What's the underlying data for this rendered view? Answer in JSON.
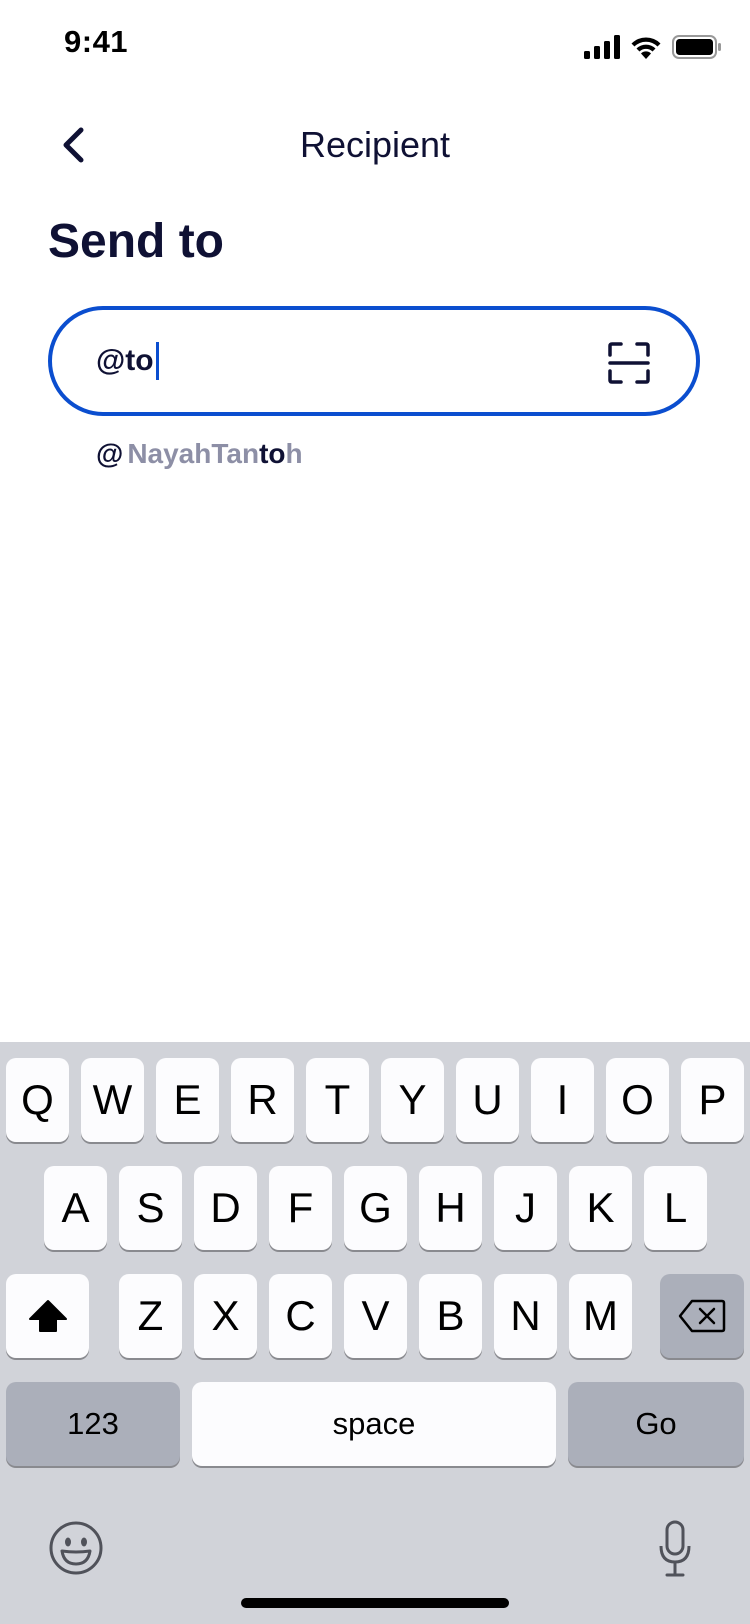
{
  "status": {
    "time": "9:41"
  },
  "header": {
    "title": "Recipient"
  },
  "page": {
    "title": "Send to"
  },
  "recipient_field": {
    "value": "@to"
  },
  "suggestion": {
    "at": "@",
    "prefix": "NayahTan",
    "match": "to",
    "suffix": "h"
  },
  "keyboard": {
    "row1": [
      "Q",
      "W",
      "E",
      "R",
      "T",
      "Y",
      "U",
      "I",
      "O",
      "P"
    ],
    "row2": [
      "A",
      "S",
      "D",
      "F",
      "G",
      "H",
      "J",
      "K",
      "L"
    ],
    "row3": [
      "Z",
      "X",
      "C",
      "V",
      "B",
      "N",
      "M"
    ],
    "numbers_label": "123",
    "space_label": "space",
    "go_label": "Go"
  },
  "colors": {
    "accent": "#0b4ecf",
    "text": "#0f1134",
    "muted": "#8d8fa6",
    "keyboard_bg": "#d1d3d9"
  }
}
